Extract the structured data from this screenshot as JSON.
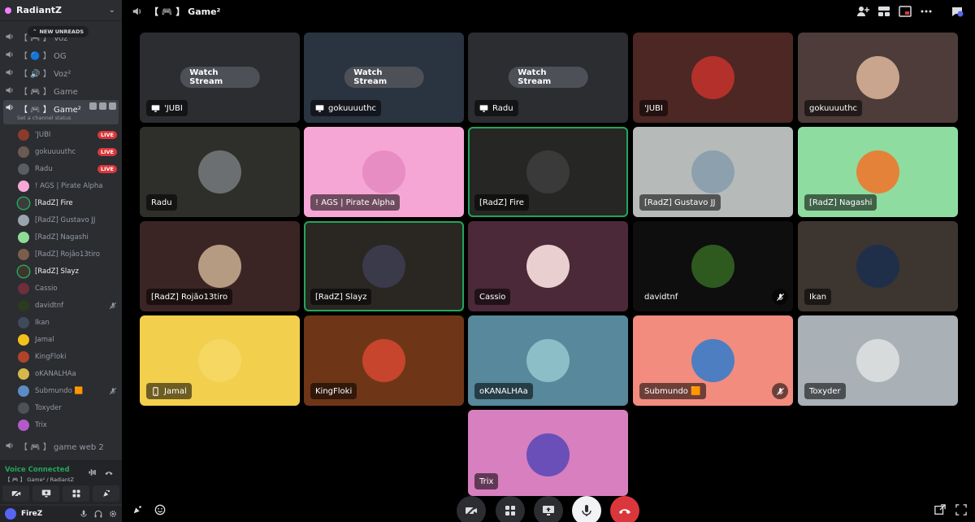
{
  "server": {
    "name": "RadiantZ"
  },
  "sidebar": {
    "new_unreads": "NEW UNREADS",
    "channels": [
      {
        "name": "【 🎮 】 Voz"
      },
      {
        "name": "【 🔵 】 OG"
      },
      {
        "name": "【 🔊 】 Voz²"
      },
      {
        "name": "【 🎮 】 Game"
      },
      {
        "name": "【 🎮 】 Game²"
      },
      {
        "name": "【 🎮 】 game web 2"
      }
    ],
    "channel_status": "Set a channel status",
    "live_label": "LIVE",
    "members": [
      {
        "name": "'JUBI",
        "color": "#8a3b2c"
      },
      {
        "name": "gokuuuuthc",
        "color": "#6b5a52"
      },
      {
        "name": "Radu",
        "color": "#5a5d63"
      },
      {
        "name": "! AGS | Pirate Alpha",
        "color": "#f5a8d6"
      },
      {
        "name": "[RadZ] Fire",
        "color": "#3c3c3c"
      },
      {
        "name": "[RadZ] Gustavo JJ",
        "color": "#9aa4ad"
      },
      {
        "name": "[RadZ] Nagashi",
        "color": "#8fdc96"
      },
      {
        "name": "[RadZ] Rojão13tiro",
        "color": "#7a5e4a"
      },
      {
        "name": "[RadZ] Slayz",
        "color": "#40352d"
      },
      {
        "name": "Cassio",
        "color": "#6e2f3a"
      },
      {
        "name": "davidtnf",
        "color": "#2b3b1e"
      },
      {
        "name": "Ikan",
        "color": "#3f4a5a"
      },
      {
        "name": "Jamal",
        "color": "#f2c21c"
      },
      {
        "name": "KingFloki",
        "color": "#b0432a"
      },
      {
        "name": "oKANALHAa",
        "color": "#d6b84a"
      },
      {
        "name": "Submundo 🟧",
        "color": "#5a8cc6"
      },
      {
        "name": "Toxyder",
        "color": "#4d5257"
      },
      {
        "name": "Trix",
        "color": "#b35ac8"
      }
    ]
  },
  "voice": {
    "status": "Voice Connected",
    "location": "【 🎮 】 Game² / RadiantZ"
  },
  "user": {
    "name": "FireZ"
  },
  "header": {
    "title": "【 🎮 】 Game²"
  },
  "watch_label": "Watch Stream",
  "tiles": [
    {
      "name": "'JUBI",
      "bg": "#2b2d31",
      "kind": "stream"
    },
    {
      "name": "gokuuuuthc",
      "bg": "#2a3440",
      "kind": "stream"
    },
    {
      "name": "Radu",
      "bg": "#2b2d31",
      "kind": "stream"
    },
    {
      "name": "'JUBI",
      "bg": "#4c2724",
      "kind": "avatar",
      "avatar_color": "#b3312a"
    },
    {
      "name": "gokuuuuthc",
      "bg": "#4d3c39",
      "kind": "avatar",
      "avatar_color": "#c9a58e"
    },
    {
      "name": "Radu",
      "bg": "#2e2f2a",
      "kind": "avatar",
      "avatar_color": "#6c6f72"
    },
    {
      "name": "! AGS | Pirate Alpha",
      "bg": "#f5a6d4",
      "kind": "avatar",
      "avatar_color": "#e88dc4"
    },
    {
      "name": "[RadZ] Fire",
      "bg": "#262625",
      "kind": "avatar",
      "avatar_color": "#3a3a3a"
    },
    {
      "name": "[RadZ] Gustavo JJ",
      "bg": "#b6bbb9",
      "kind": "avatar",
      "avatar_color": "#8da0ad"
    },
    {
      "name": "[RadZ] Nagashi",
      "bg": "#8fdca0",
      "kind": "avatar",
      "avatar_color": "#e5823a"
    },
    {
      "name": "[RadZ] Rojão13tiro",
      "bg": "#3b2524",
      "kind": "avatar",
      "avatar_color": "#b59b82"
    },
    {
      "name": "[RadZ] Slayz",
      "bg": "#2a2622",
      "kind": "avatar",
      "avatar_color": "#3a3a4a"
    },
    {
      "name": "Cassio",
      "bg": "#4b2938",
      "kind": "avatar",
      "avatar_color": "#e9cfd0"
    },
    {
      "name": "davidtnf",
      "bg": "#0e0e0e",
      "kind": "avatar",
      "avatar_color": "#2f5a1f"
    },
    {
      "name": "Ikan",
      "bg": "#3d3530",
      "kind": "avatar",
      "avatar_color": "#1f2f4a"
    },
    {
      "name": "Jamal",
      "bg": "#f2cf4c",
      "kind": "avatar",
      "avatar_color": "#f5d762"
    },
    {
      "name": "KingFloki",
      "bg": "#6e3617",
      "kind": "avatar",
      "avatar_color": "#c6452c"
    },
    {
      "name": "oKANALHAa",
      "bg": "#57889b",
      "kind": "avatar",
      "avatar_color": "#8bbec6"
    },
    {
      "name": "Submundo 🟧",
      "bg": "#f28c7f",
      "kind": "avatar",
      "avatar_color": "#4d7ec2"
    },
    {
      "name": "Toxyder",
      "bg": "#a9b0b6",
      "kind": "avatar",
      "avatar_color": "#d7dbdc"
    },
    {
      "name": "Trix",
      "bg": "#d77fbf",
      "kind": "avatar",
      "avatar_color": "#6a4fb8"
    }
  ]
}
